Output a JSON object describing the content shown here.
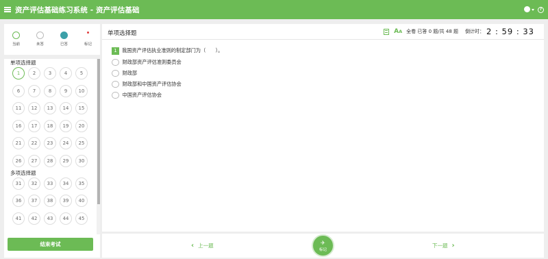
{
  "app": {
    "title": "资产评估基础练习系统 - 资产评估基础"
  },
  "legend": [
    {
      "label": "当前",
      "icon": "current-circle"
    },
    {
      "label": "未答",
      "icon": "unanswered-circle"
    },
    {
      "label": "已答",
      "icon": "answered-circle"
    },
    {
      "label": "标记",
      "icon": "flag-dot"
    }
  ],
  "sections": [
    {
      "title": "单项选择题",
      "numbers": [
        "1",
        "2",
        "3",
        "4",
        "5",
        "6",
        "7",
        "8",
        "9",
        "10",
        "11",
        "12",
        "13",
        "14",
        "15",
        "16",
        "17",
        "18",
        "19",
        "20",
        "21",
        "22",
        "23",
        "24",
        "25",
        "26",
        "27",
        "28",
        "29",
        "30"
      ]
    },
    {
      "title": "多项选择题",
      "numbers": [
        "31",
        "32",
        "33",
        "34",
        "35",
        "36",
        "37",
        "38",
        "39",
        "40",
        "41",
        "42",
        "43",
        "44",
        "45"
      ]
    }
  ],
  "current_question": "1",
  "finish_label": "结束考试",
  "main": {
    "type_title": "单项选择题",
    "font_icon": "A",
    "progress_text": "全卷 已答 0 题/共 48 题",
    "countdown_label": "倒计时：",
    "countdown": "2 : 59 : 33"
  },
  "question": {
    "number": "1",
    "stem": "我国资产评估执业准则的制定部门为（　　）。",
    "options": [
      "财政部资产评估准则委员会",
      "财政部",
      "财政部和中国资产评估协会",
      "中国资产评估协会"
    ]
  },
  "nav": {
    "prev_label": "上一题",
    "next_label": "下一题",
    "mark_label": "标记"
  },
  "colors": {
    "accent": "#6cbb55",
    "answered": "#3ca0a8",
    "flag": "#e03d3d",
    "background": "#eeeeee"
  },
  "icons": {
    "menu": "hamburger-icon",
    "user": "user-icon",
    "help": "help-icon",
    "calculator": "calculator-icon",
    "pin": "pin-icon"
  }
}
